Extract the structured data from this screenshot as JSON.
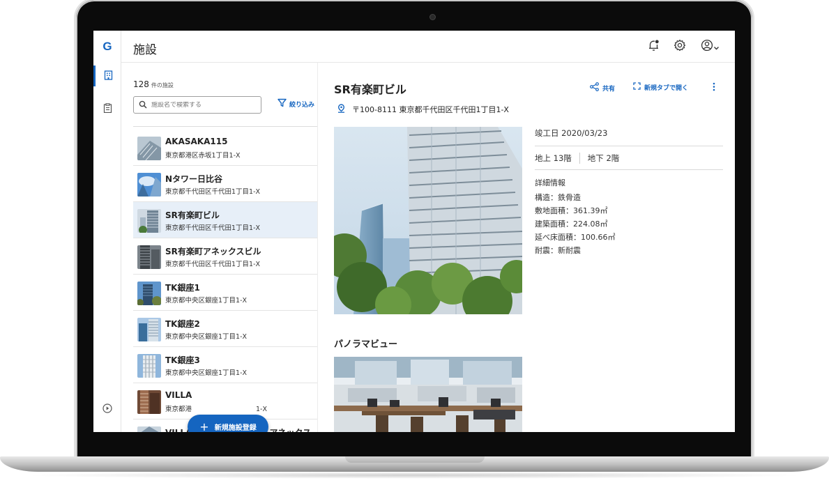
{
  "header": {
    "title": "施設"
  },
  "rail": {
    "logo": "G"
  },
  "list": {
    "count": "128",
    "count_unit": "件の施設",
    "search_placeholder": "施設名で検索する",
    "filter_label": "絞り込み",
    "items": [
      {
        "name": "AKASAKA115",
        "address": "東京都港区赤坂1丁目1-X"
      },
      {
        "name": "Nタワー日比谷",
        "address": "東京都千代田区千代田1丁目1-X"
      },
      {
        "name": "SR有楽町ビル",
        "address": "東京都千代田区千代田1丁目1-X"
      },
      {
        "name": "SR有楽町アネックスビル",
        "address": "東京都千代田区千代田1丁目1-X"
      },
      {
        "name": "TK銀座1",
        "address": "東京都中央区銀座1丁目1-X"
      },
      {
        "name": "TK銀座2",
        "address": "東京都中央区銀座1丁目1-X"
      },
      {
        "name": "TK銀座3",
        "address": "東京都中央区銀座1丁目1-X"
      },
      {
        "name": "VILLA",
        "address": "東京都港",
        "address_tail": "1-X"
      },
      {
        "name": "VILLAGE GARDEN 赤坂 アネックス",
        "address": ""
      }
    ],
    "selected_index": 2,
    "fab_label": "新規施設登録"
  },
  "detail": {
    "name": "SR有楽町ビル",
    "share_label": "共有",
    "open_tab_label": "新規タブで開く",
    "address": "〒100-8111 東京都千代田区千代田1丁目1-X",
    "completion": "竣工日  2020/03/23",
    "floors_above": "地上  13階",
    "floors_below": "地下  2階",
    "details_heading": "詳細情報",
    "structure": "構造：鉄骨造",
    "site_area": "敷地面積：361.39㎡",
    "building_area": "建築面積：224.08㎡",
    "floor_area": "延べ床面積：100.66㎡",
    "seismic": "耐震：新耐震",
    "panorama_heading": "パノラマビュー"
  },
  "icons": {
    "header": [
      "notification-bell-icon",
      "gear-icon",
      "account-icon",
      "chevron-down-icon"
    ],
    "rail": [
      "building-icon",
      "clipboard-icon",
      "play-circle-icon"
    ]
  },
  "colors": {
    "accent": "#1565c0",
    "selected_row": "#e7eff8"
  }
}
